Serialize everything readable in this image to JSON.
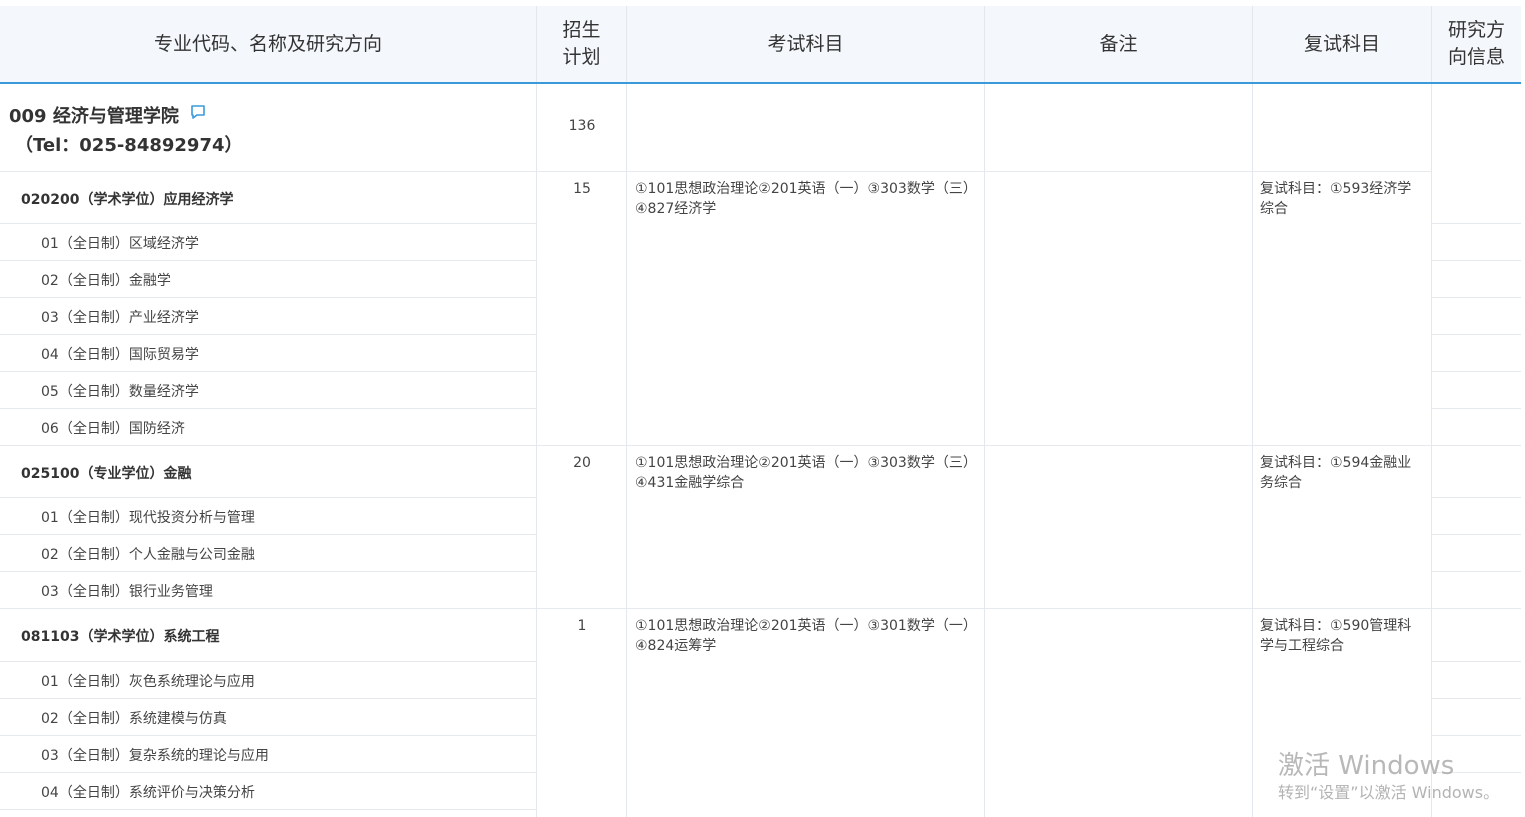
{
  "header": {
    "col_major": "专业代码、名称及研究方向",
    "col_plan_l1": "招生",
    "col_plan_l2": "计划",
    "col_exam": "考试科目",
    "col_note": "备注",
    "col_retest": "复试科目",
    "col_dir_l1": "研究方",
    "col_dir_l2": "向信息"
  },
  "college": {
    "name": "009 经济与管理学院",
    "tel": "（Tel：025-84892974）",
    "plan": "136",
    "icon": "comment-icon",
    "accent": "#3a9ad9"
  },
  "majors": [
    {
      "label": "020200（学术学位）应用经济学",
      "plan": "15",
      "exam_l1": "①101思想政治理论②201英语（一）③303数学（三）",
      "exam_l2": "④827经济学",
      "retest_l1": "复试科目：①593经济学",
      "retest_l2": "综合",
      "directions": [
        "01（全日制）区域经济学",
        "02（全日制）金融学",
        "03（全日制）产业经济学",
        "04（全日制）国际贸易学",
        "05（全日制）数量经济学",
        "06（全日制）国防经济"
      ]
    },
    {
      "label": "025100（专业学位）金融",
      "plan": "20",
      "exam_l1": "①101思想政治理论②201英语（一）③303数学（三）",
      "exam_l2": "④431金融学综合",
      "retest_l1": "复试科目：①594金融业",
      "retest_l2": "务综合",
      "directions": [
        "01（全日制）现代投资分析与管理",
        "02（全日制）个人金融与公司金融",
        "03（全日制）银行业务管理"
      ]
    },
    {
      "label": "081103（学术学位）系统工程",
      "plan": "1",
      "exam_l1": "①101思想政治理论②201英语（一）③301数学（一）",
      "exam_l2": "④824运筹学",
      "retest_l1": "复试科目：①590管理科",
      "retest_l2": "学与工程综合",
      "directions": [
        "01（全日制）灰色系统理论与应用",
        "02（全日制）系统建模与仿真",
        "03（全日制）复杂系统的理论与应用",
        "04（全日制）系统评价与决策分析"
      ]
    }
  ],
  "watermark": {
    "line1": "激活 Windows",
    "line2": "转到“设置”以激活 Windows。"
  }
}
